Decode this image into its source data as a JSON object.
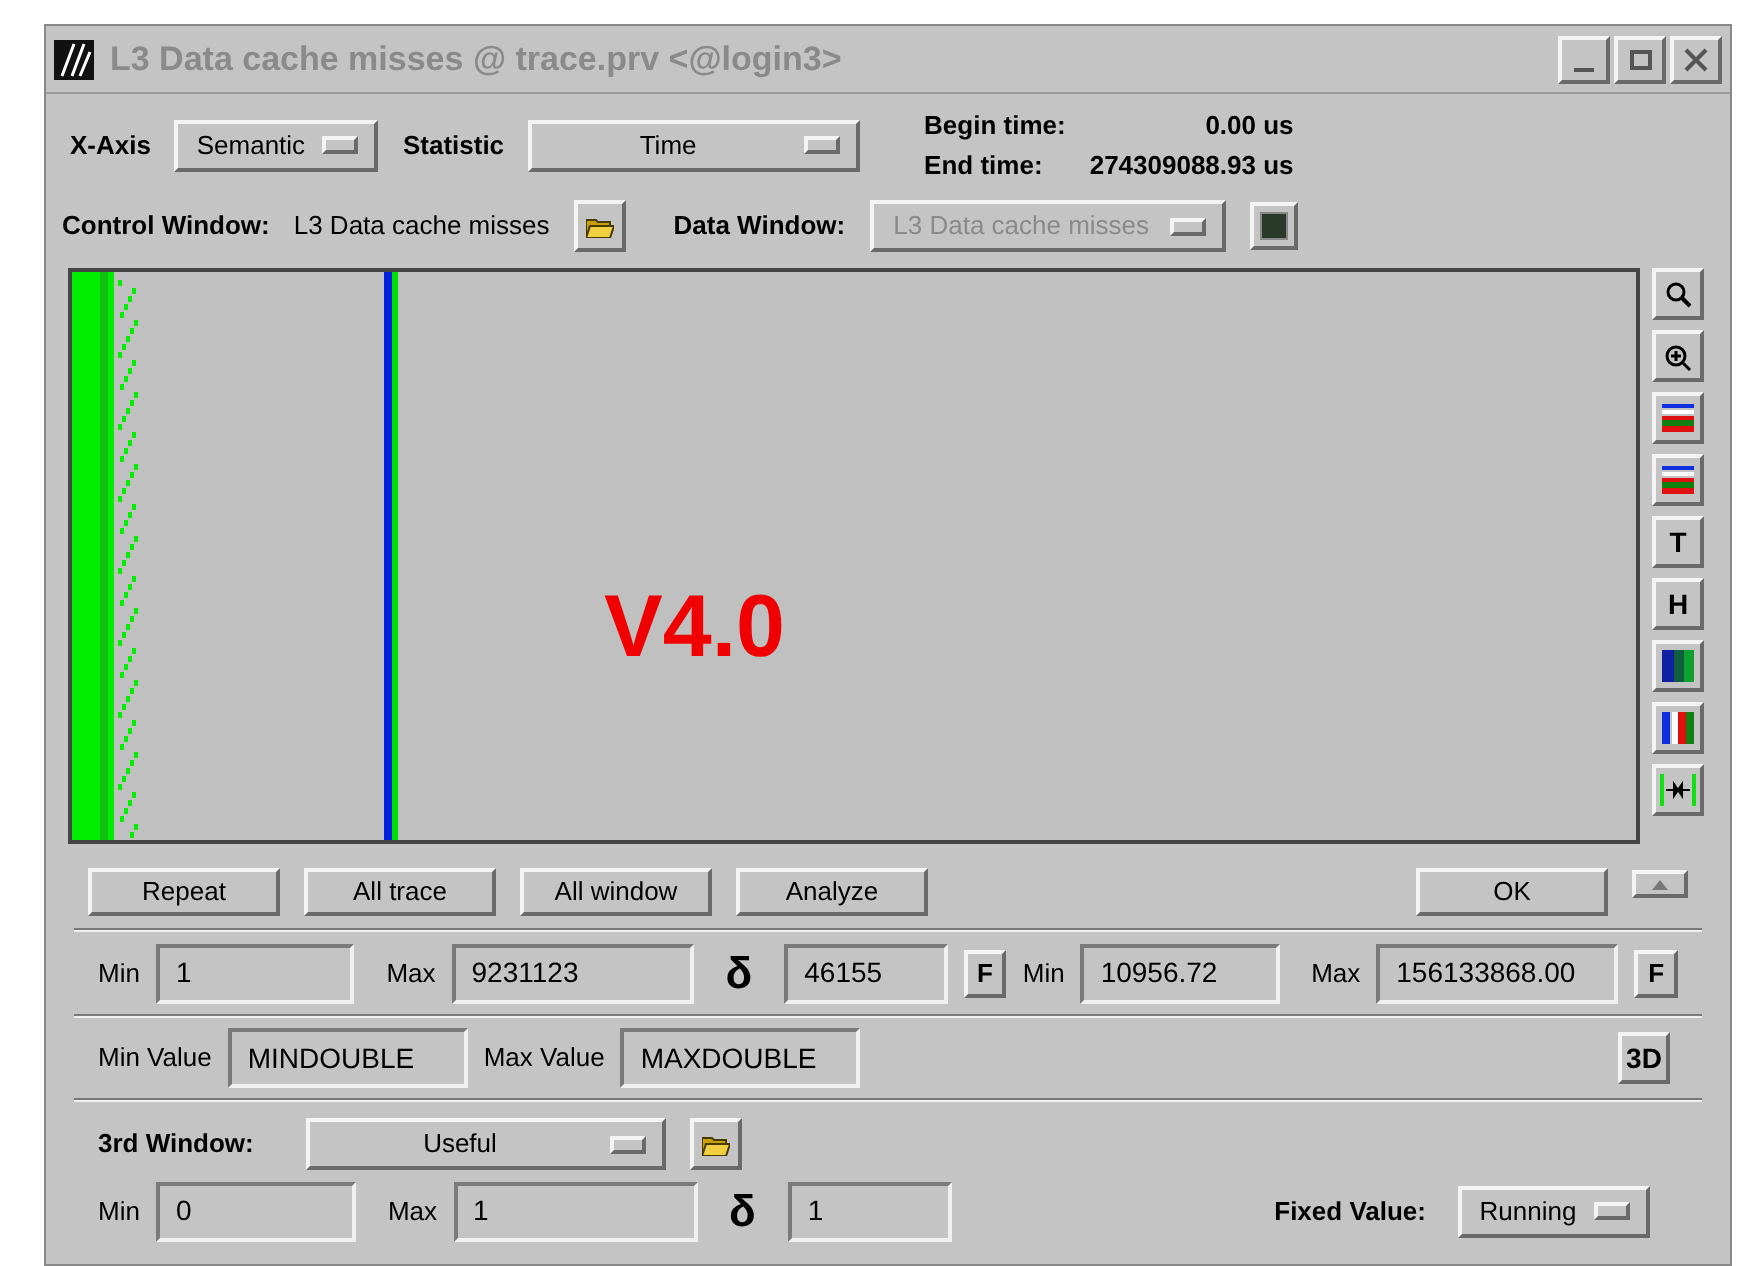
{
  "window": {
    "title": "L3 Data cache misses @ trace.prv <@login3>"
  },
  "x_axis": {
    "label": "X-Axis",
    "value": "Semantic"
  },
  "statistic": {
    "label": "Statistic",
    "value": "Time"
  },
  "times": [
    {
      "label": "Begin time:",
      "value": "0.00 us"
    },
    {
      "label": "End time:",
      "value": "274309088.93 us"
    }
  ],
  "control_window": {
    "label": "Control Window:",
    "value": "L3 Data cache misses"
  },
  "data_window": {
    "label": "Data Window:",
    "value": "L3 Data cache misses",
    "disabled": true
  },
  "canvas": {
    "overlay": "V4.0"
  },
  "tools": [
    {
      "kind": "zoom"
    },
    {
      "kind": "zoom-plus"
    },
    {
      "kind": "lines"
    },
    {
      "kind": "lines"
    },
    {
      "kind": "text",
      "label": "T"
    },
    {
      "kind": "text",
      "label": "H"
    },
    {
      "kind": "gradient"
    },
    {
      "kind": "bars"
    },
    {
      "kind": "arrows"
    }
  ],
  "buttons": [
    "Repeat",
    "All trace",
    "All window",
    "Analyze"
  ],
  "ok_button": "OK",
  "columns_row": {
    "min_label": "Min",
    "min": "1",
    "max_label": "Max",
    "max": "9231123",
    "delta_label": "δ",
    "delta": "46155",
    "fit": "F"
  },
  "values_row": {
    "min_label": "Min",
    "min": "10956.72",
    "max_label": "Max",
    "max": "156133868.00",
    "fit": "F"
  },
  "limits_row": {
    "min_label": "Min Value",
    "min": "MINDOUBLE",
    "max_label": "Max Value",
    "max": "MAXDOUBLE",
    "button": "3D"
  },
  "third_window": {
    "label": "3rd Window:",
    "value": "Useful"
  },
  "third_row": {
    "min_label": "Min",
    "min": "0",
    "max_label": "Max",
    "max": "1",
    "delta_label": "δ",
    "delta": "1"
  },
  "fixed_value": {
    "label": "Fixed Value:",
    "value": "Running"
  }
}
